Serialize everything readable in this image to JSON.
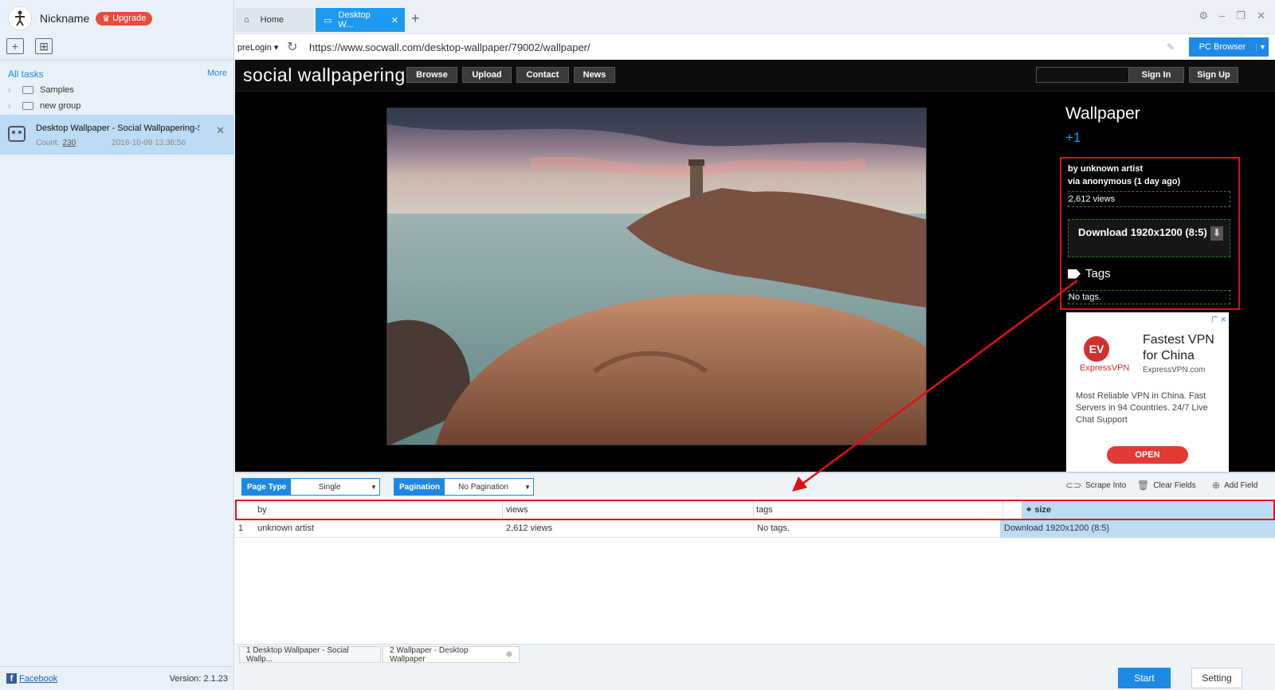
{
  "user": {
    "nickname": "Nickname",
    "upgrade_label": "Upgrade"
  },
  "sidebar": {
    "all_tasks_label": "All tasks",
    "more_label": "More",
    "groups": [
      "Samples",
      "new group"
    ],
    "task": {
      "title": "Desktop Wallpaper - Social Wallpapering-S...",
      "count_label": "Count:",
      "count": "230",
      "date": "2018-10-09 13:38:56"
    },
    "footer": {
      "facebook_label": "Facebook",
      "version": "Version: 2.1.23"
    }
  },
  "browser": {
    "tabs": [
      {
        "label": "Home"
      },
      {
        "label": "Desktop W..."
      }
    ],
    "prelogin_label": "preLogin",
    "url": "https://www.socwall.com/desktop-wallpaper/79002/wallpaper/",
    "pc_browser_label": "PC Browser"
  },
  "site": {
    "logo": "social wallpapering",
    "nav": [
      "Browse",
      "Upload",
      "Contact",
      "News"
    ],
    "sign_in": "Sign In",
    "sign_up": "Sign Up",
    "wallpaper_title": "Wallpaper",
    "plus_one": "+1",
    "by_line": "by unknown artist",
    "via_line": "via anonymous (1 day ago)",
    "views": "2,612 views",
    "download": "Download 1920x1200 (8:5)",
    "tags_label": "Tags",
    "no_tags": "No tags."
  },
  "ad": {
    "brand": "ExpressVPN",
    "logo_text": "EV",
    "title": "Fastest VPN for China",
    "domain": "ExpressVPN.com",
    "text": "Most Reliable VPN in China. Fast Servers in 94 Countries. 24/7 Live Chat Support",
    "open_label": "OPEN"
  },
  "panel": {
    "page_type_label": "Page Type",
    "page_type_value": "Single",
    "pagination_label": "Pagination",
    "pagination_value": "No Pagination",
    "actions": [
      "Scrape Into",
      "Clear Fields",
      "Add Field"
    ],
    "columns": [
      "by",
      "views",
      "tags",
      "size"
    ],
    "rows": [
      {
        "index": "1",
        "by": "unknown artist",
        "views": "2,612 views",
        "tags": "No tags.",
        "size": "Download 1920x1200 (8:5)"
      }
    ],
    "page_tabs": [
      "1 Desktop Wallpaper - Social Wallp...",
      "2 Wallpaper - Desktop Wallpaper"
    ],
    "start_label": "Start",
    "setting_label": "Setting"
  },
  "colors": {
    "accent": "#1e88e5",
    "highlight": "#e01010",
    "selected": "#bcdcf5"
  }
}
